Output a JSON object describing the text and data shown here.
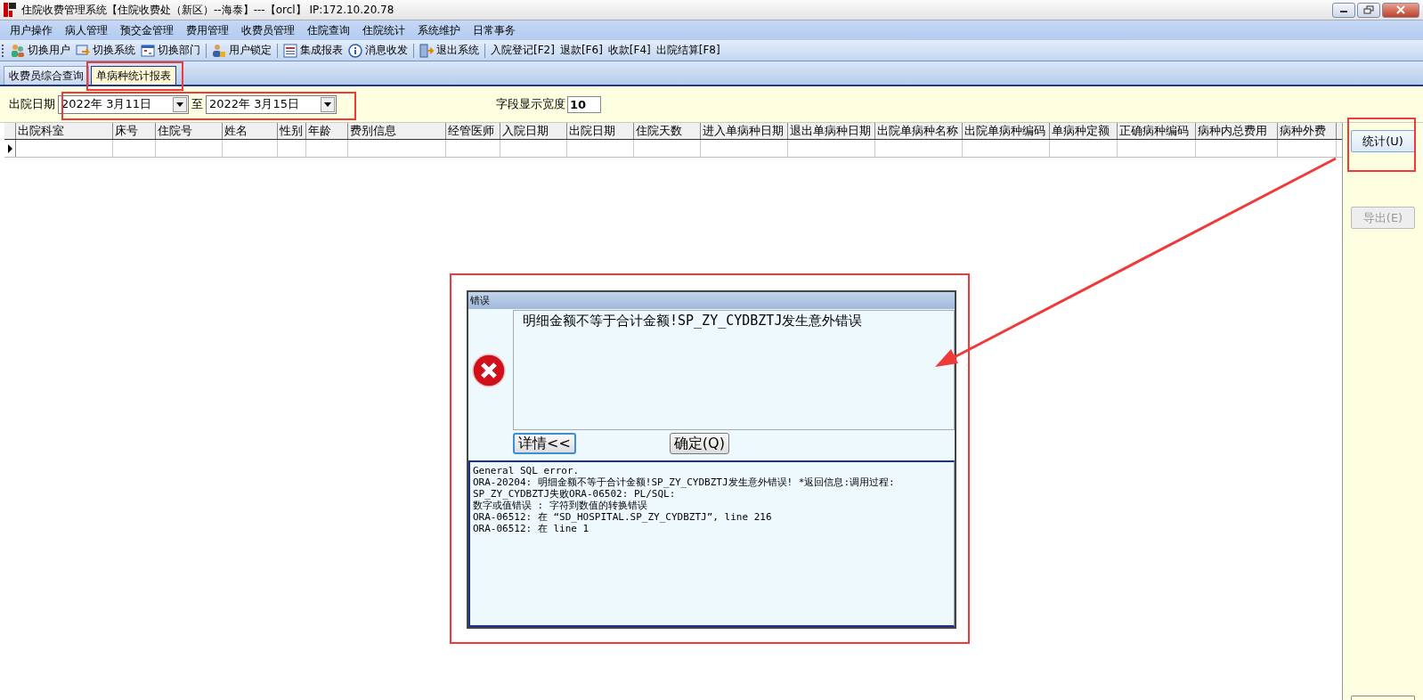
{
  "window": {
    "title": "住院收费管理系统【住院收费处（新区）--海泰】---【orcl】 IP:172.10.20.78"
  },
  "menu": [
    "用户操作",
    "病人管理",
    "预交金管理",
    "费用管理",
    "收费员管理",
    "住院查询",
    "住院统计",
    "系统维护",
    "日常事务"
  ],
  "toolbar": {
    "groups": [
      [
        {
          "label": "切换用户",
          "kind": "icon"
        },
        {
          "label": "切换系统",
          "kind": "icon"
        },
        {
          "label": "切换部门",
          "kind": "icon"
        }
      ],
      [
        {
          "label": "用户锁定",
          "kind": "icon"
        }
      ],
      [
        {
          "label": "集成报表",
          "kind": "icon"
        },
        {
          "label": "消息收发",
          "kind": "icon"
        }
      ],
      [
        {
          "label": "退出系统",
          "kind": "icon"
        }
      ],
      [
        {
          "label": "入院登记[F2]",
          "kind": "text"
        },
        {
          "label": "退款[F6]",
          "kind": "text"
        },
        {
          "label": "收款[F4]",
          "kind": "text"
        },
        {
          "label": "出院结算[F8]",
          "kind": "text"
        }
      ]
    ]
  },
  "tabs": [
    {
      "label": "收费员综合查询",
      "selected": false
    },
    {
      "label": "单病种统计报表",
      "selected": true
    }
  ],
  "filter": {
    "label": "出院日期",
    "from": "2022年  3月11日",
    "to_label": "至",
    "to": "2022年  3月15日",
    "width_label": "字段显示宽度",
    "width_value": "10"
  },
  "table": {
    "columns": [
      "出院科室",
      "床号",
      "住院号",
      "姓名",
      "性别",
      "年龄",
      "费别信息",
      "经管医师",
      "入院日期",
      "出院日期",
      "住院天数",
      "进入单病种日期",
      "退出单病种日期",
      "出院单病种名称",
      "出院单病种编码",
      "单病种定额",
      "正确病种编码",
      "病种内总费用",
      "病种外费"
    ]
  },
  "side_buttons": [
    {
      "label": "统计(U)",
      "disabled": false
    },
    {
      "label": "导出(E)",
      "disabled": true
    }
  ],
  "dialog": {
    "title": "错误",
    "message": "明细金额不等于合计金额!SP_ZY_CYDBZTJ发生意外错误",
    "buttons": [
      "详情<<",
      "确定(Q)"
    ],
    "details": [
      "General SQL error.",
      "ORA-20204: 明细金额不等于合计金额!SP_ZY_CYDBZTJ发生意外错误! *返回信息:调用过程:",
      "SP_ZY_CYDBZTJ失败ORA-06502: PL/SQL:",
      "数字或值错误 :  字符到数值的转换错误",
      "ORA-06512: 在 “SD_HOSPITAL.SP_ZY_CYDBZTJ”, line 216",
      "ORA-06512: 在 line 1"
    ]
  }
}
